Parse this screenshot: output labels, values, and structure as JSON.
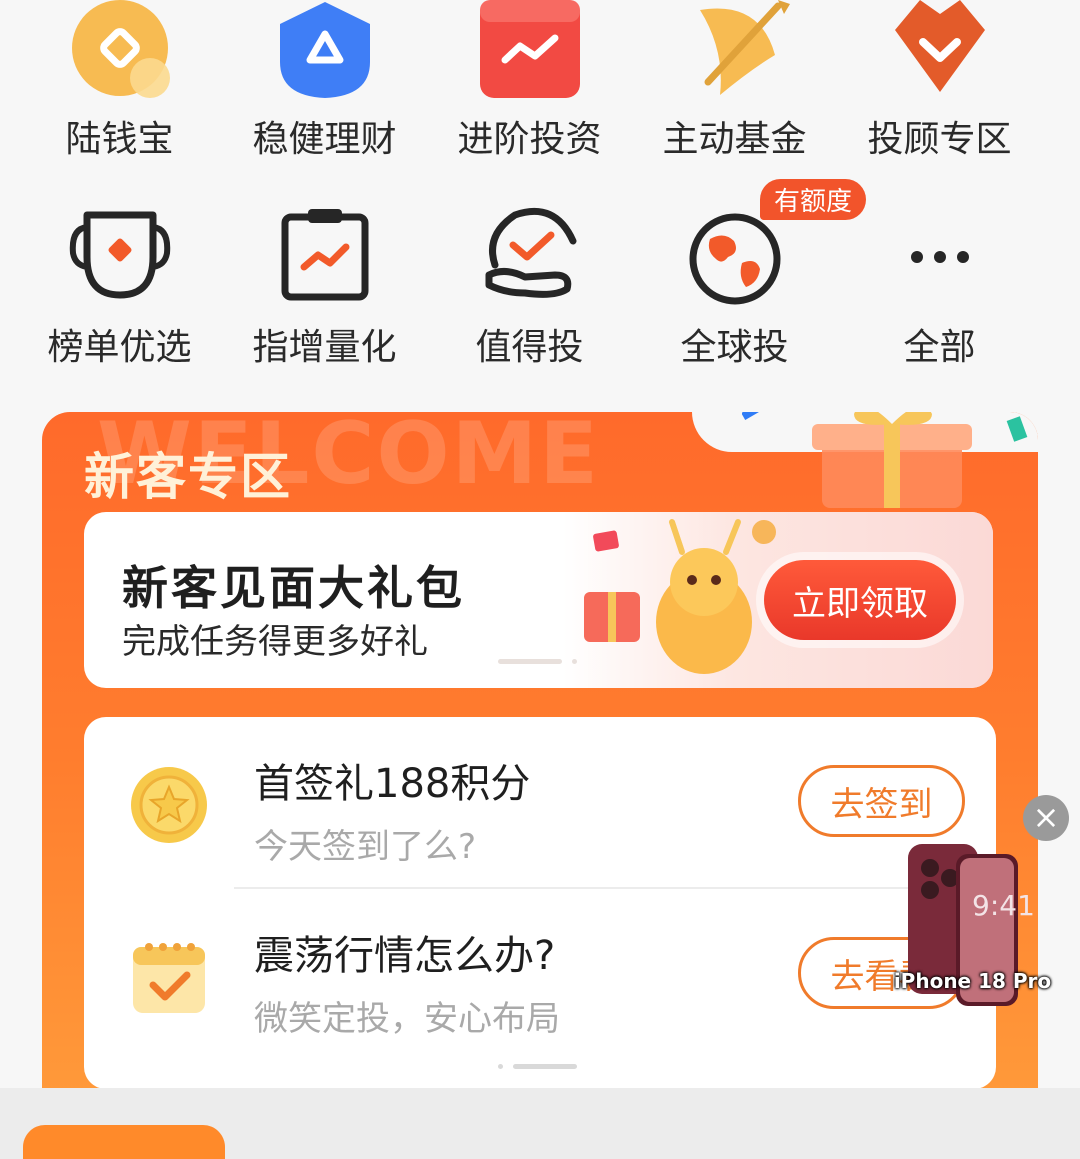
{
  "grid_row1": [
    {
      "label": "陆钱宝",
      "icon": "coin-icon"
    },
    {
      "label": "稳健理财",
      "icon": "shield-icon"
    },
    {
      "label": "进阶投资",
      "icon": "trend-calendar-icon"
    },
    {
      "label": "主动基金",
      "icon": "archery-icon"
    },
    {
      "label": "投顾专区",
      "icon": "chevron-shield-icon"
    }
  ],
  "grid_row2": [
    {
      "label": "榜单优选",
      "icon": "trophy-icon"
    },
    {
      "label": "指增量化",
      "icon": "clipboard-chart-icon"
    },
    {
      "label": "值得投",
      "icon": "hand-check-icon"
    },
    {
      "label": "全球投",
      "icon": "globe-icon",
      "badge": "有额度"
    },
    {
      "label": "全部",
      "icon": "more-icon"
    }
  ],
  "newbie": {
    "watermark": "WELCOME",
    "title": "新客专区",
    "gift": {
      "title": "新客见面大礼包",
      "subtitle": "完成任务得更多好礼",
      "button": "立即领取"
    },
    "tasks": [
      {
        "title": "首签礼188积分",
        "subtitle": "今天签到了么?",
        "button": "去签到",
        "icon": "gold-star-coin-icon"
      },
      {
        "title": "震荡行情怎么办?",
        "subtitle": "微笑定投，安心布局",
        "button": "去看看",
        "icon": "calendar-check-icon"
      }
    ]
  },
  "float_ad": {
    "label": "iPhone 18 Pro",
    "close": "×"
  },
  "colors": {
    "accent": "#f07b2b",
    "orange": "#ff6a2b",
    "red_button": "#e9382a"
  }
}
